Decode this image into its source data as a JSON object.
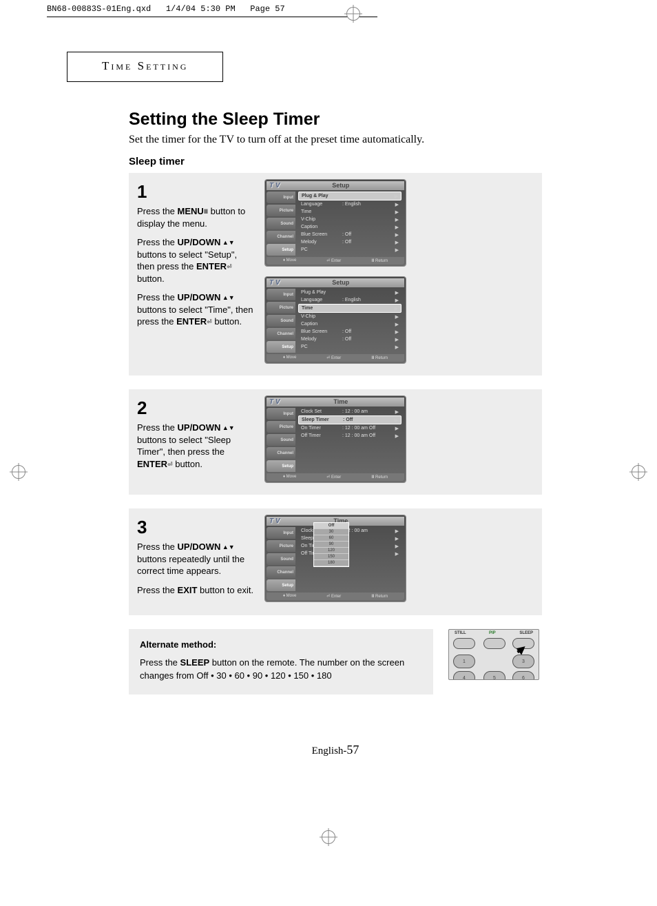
{
  "crop": {
    "file": "BN68-00883S-01Eng.qxd",
    "date": "1/4/04 5:30 PM",
    "page": "Page 57"
  },
  "section_box": "Time Setting",
  "title": "Setting the Sleep Timer",
  "lead": "Set the timer for the TV to turn off at the preset time automatically.",
  "subhead": "Sleep timer",
  "steps": {
    "s1": {
      "num": "1",
      "p1a": "Press the ",
      "p1b": "MENU",
      "p1c": " button to display the menu.",
      "p2a": "Press the ",
      "p2b": "UP/DOWN",
      "p2c": " buttons to select \"Setup\", then press the ",
      "p2d": "ENTER",
      "p2e": " button.",
      "p3a": "Press the ",
      "p3b": "UP/DOWN",
      "p3c": " buttons to select \"Time\", then press the ",
      "p3d": "ENTER",
      "p3e": " button."
    },
    "s2": {
      "num": "2",
      "p1a": "Press the ",
      "p1b": "UP/DOWN",
      "p1c": " buttons to select \"Sleep Timer\", then press the ",
      "p1d": "ENTER",
      "p1e": " button."
    },
    "s3": {
      "num": "3",
      "p1a": "Press the ",
      "p1b": "UP/DOWN",
      "p1c": " buttons repeatedly until the correct time appears.",
      "p2a": "Press the ",
      "p2b": "EXIT",
      "p2c": " button to exit."
    }
  },
  "osd": {
    "tv": "T V",
    "tabs": [
      "Input",
      "Picture",
      "Sound",
      "Channel",
      "Setup"
    ],
    "footer": {
      "move": "Move",
      "enter": "Enter",
      "return": "Return"
    },
    "screen1": {
      "title": "Setup",
      "rows": [
        {
          "lbl": "Plug & Play",
          "val": "",
          "sel": true
        },
        {
          "lbl": "Language",
          "val": ": English"
        },
        {
          "lbl": "Time",
          "val": ""
        },
        {
          "lbl": "V-Chip",
          "val": ""
        },
        {
          "lbl": "Caption",
          "val": ""
        },
        {
          "lbl": "Blue Screen",
          "val": ": Off"
        },
        {
          "lbl": "Melody",
          "val": ": Off"
        },
        {
          "lbl": "PC",
          "val": ""
        }
      ]
    },
    "screen2": {
      "title": "Setup",
      "rows": [
        {
          "lbl": "Plug & Play",
          "val": ""
        },
        {
          "lbl": "Language",
          "val": ": English"
        },
        {
          "lbl": "Time",
          "val": "",
          "sel": true
        },
        {
          "lbl": "V-Chip",
          "val": ""
        },
        {
          "lbl": "Caption",
          "val": ""
        },
        {
          "lbl": "Blue Screen",
          "val": ": Off"
        },
        {
          "lbl": "Melody",
          "val": ": Off"
        },
        {
          "lbl": "PC",
          "val": ""
        }
      ]
    },
    "screen3": {
      "title": "Time",
      "rows": [
        {
          "lbl": "Clock Set",
          "val": ": 12 : 00  am"
        },
        {
          "lbl": "Sleep Timer",
          "val": ":           Off",
          "sel": true
        },
        {
          "lbl": "On Timer",
          "val": ": 12 : 00  am Off"
        },
        {
          "lbl": "Off Timer",
          "val": ": 12 : 00  am Off"
        }
      ]
    },
    "screen4": {
      "title": "Time",
      "rows": [
        {
          "lbl": "Clock Set",
          "val": ": 12 : 00  am"
        },
        {
          "lbl": "Sleep Timer",
          "val": ":"
        },
        {
          "lbl": "On Timer",
          "val": ":"
        },
        {
          "lbl": "Off Timer",
          "val": ":"
        }
      ],
      "dropdown": [
        "Off",
        "30",
        "60",
        "90",
        "120",
        "150",
        "180"
      ]
    }
  },
  "alt": {
    "head": "Alternate method:",
    "p1a": "Press the ",
    "p1b": "SLEEP",
    "p1c": " button on the remote. The number on the screen changes from Off • 30 • 60 • 90 • 120 • 150 • 180"
  },
  "remote": {
    "labels": {
      "still": "STILL",
      "pip": "PIP",
      "sleep": "SLEEP"
    },
    "nums": {
      "n1": "1",
      "n3": "3",
      "n4": "4",
      "n5": "5",
      "n6": "6"
    }
  },
  "footer": {
    "lang": "English-",
    "page": "57"
  }
}
